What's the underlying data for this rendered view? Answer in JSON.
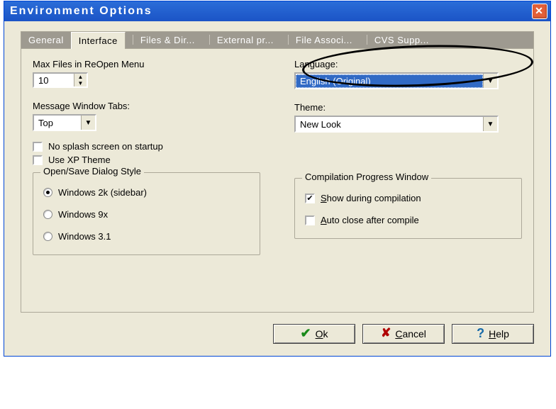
{
  "title": "Environment Options",
  "tabs": [
    "General",
    "Interface",
    "Files & Dir...",
    "External pr...",
    "File Associ...",
    "CVS Supp..."
  ],
  "active_tab": 1,
  "left": {
    "maxfiles_label": "Max Files in ReOpen Menu",
    "maxfiles_value": "10",
    "msgtabs_label": "Message Window Tabs:",
    "msgtabs_value": "Top",
    "chk_nosplash": "No splash screen on startup",
    "chk_xptheme": "Use XP Theme",
    "groupbox_title": "Open/Save Dialog Style",
    "radio_w2k": "Windows 2k (sidebar)",
    "radio_w9x": "Windows 9x",
    "radio_w31": "Windows 3.1"
  },
  "right": {
    "lang_label": "Language:",
    "lang_value": "English (Original)",
    "theme_label": "Theme:",
    "theme_value": "New Look",
    "groupbox_title": "Compilation Progress Window",
    "chk_show_prefix": "S",
    "chk_show_rest": "how during compilation",
    "chk_auto_prefix": "A",
    "chk_auto_rest": "uto close after compile"
  },
  "buttons": {
    "ok_u": "O",
    "ok_rest": "k",
    "cancel_u": "C",
    "cancel_rest": "ancel",
    "help_u": "H",
    "help_rest": "elp"
  }
}
